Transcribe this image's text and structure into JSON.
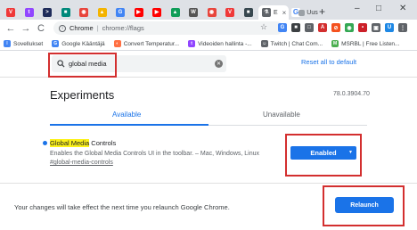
{
  "browser": {
    "tabs": [
      {
        "icon": "vivaldi-icon",
        "glyph": "V",
        "color": "#ef3939"
      },
      {
        "icon": "twitch-icon",
        "glyph": "t",
        "color": "#9146ff"
      },
      {
        "icon": "terminal-icon",
        "glyph": ">",
        "color": "#1f2c5a"
      },
      {
        "icon": "bookmark-icon",
        "glyph": "■",
        "color": "#00897b"
      },
      {
        "icon": "chrome-icon",
        "glyph": "◉",
        "color": "#e8453c"
      },
      {
        "icon": "puzzle-icon",
        "glyph": "▲",
        "color": "#f4b400"
      },
      {
        "icon": "google-icon",
        "glyph": "G",
        "color": "#4285f4"
      },
      {
        "icon": "youtube-icon",
        "glyph": "▶",
        "color": "#ff0000"
      },
      {
        "icon": "youtube-icon",
        "glyph": "▶",
        "color": "#ff0000"
      },
      {
        "icon": "drive-icon",
        "glyph": "▲",
        "color": "#0f9d58"
      },
      {
        "icon": "wikipedia-icon",
        "glyph": "W",
        "color": "#555555"
      },
      {
        "icon": "chrome-icon",
        "glyph": "◉",
        "color": "#e8453c"
      },
      {
        "icon": "vivaldi-icon",
        "glyph": "V",
        "color": "#ef3939"
      },
      {
        "icon": "bookmark-icon",
        "glyph": "■",
        "color": "#37474f"
      }
    ],
    "active_tab": {
      "label": "E",
      "close": "×"
    },
    "extra_tabs": [
      {
        "label": "G",
        "icon": "google-icon"
      },
      {
        "label": "Uus",
        "icon": "page-icon"
      }
    ],
    "new_tab": "+",
    "window_controls": {
      "minimize": "–",
      "maximize": "□",
      "close": "✕"
    }
  },
  "toolbar": {
    "back": "←",
    "forward": "→",
    "reload": "C",
    "url_scheme": "Chrome",
    "url_separator": "|",
    "url_host": "chrome://flags",
    "star": "☆"
  },
  "extensions": [
    {
      "icon": "google-icon",
      "glyph": "G",
      "color": "#4285f4"
    },
    {
      "icon": "extension-icon",
      "glyph": "■",
      "color": "#3c4043"
    },
    {
      "icon": "window-icon",
      "glyph": "□",
      "color": "#5f6368"
    },
    {
      "icon": "adblock-icon",
      "glyph": "A",
      "color": "#d32f2f"
    },
    {
      "icon": "blocker-icon",
      "glyph": "⊘",
      "color": "#f4511e"
    },
    {
      "icon": "chrome-icon",
      "glyph": "◉",
      "color": "#34a853"
    },
    {
      "icon": "lastpass-icon",
      "glyph": "•",
      "color": "#cc2029"
    },
    {
      "icon": "cast-icon",
      "glyph": "▣",
      "color": "#5f6368"
    },
    {
      "icon": "avatar-icon",
      "glyph": "U",
      "color": "#1e88e5"
    },
    {
      "icon": "menu-icon",
      "glyph": "⋮",
      "color": "#5f6368"
    }
  ],
  "bookmarks": [
    {
      "label": "Sovellukset",
      "icon": "apps-icon",
      "glyph": "⁞",
      "color": "#4285f4"
    },
    {
      "label": "Google Kääntäjä",
      "icon": "translate-icon",
      "glyph": "G",
      "color": "#4285f4"
    },
    {
      "label": "Convert Temperatur...",
      "icon": "convert-icon",
      "glyph": "◐",
      "color": "#ff7043"
    },
    {
      "label": "Videoiden hallinta -...",
      "icon": "twitch-icon",
      "glyph": "t",
      "color": "#9146ff"
    },
    {
      "label": "Twitch | Chat Com...",
      "icon": "chat-icon",
      "glyph": "☺",
      "color": "#5f6368"
    },
    {
      "label": "MSRBL | Free Listen...",
      "icon": "msrbl-icon",
      "glyph": "M",
      "color": "#4caf50"
    }
  ],
  "flags": {
    "search_value": "global media",
    "reset_all": "Reset all to default",
    "page_title": "Experiments",
    "version": "78.0.3904.70",
    "tab_available": "Available",
    "tab_unavailable": "Unavailable",
    "experiment": {
      "name_highlight": "Global Media",
      "name_rest": " Controls",
      "description": "Enables the Global Media Controls UI in the toolbar. – Mac, Windows, Linux",
      "anchor": "#global-media-controls",
      "state": "Enabled"
    },
    "relaunch_message": "Your changes will take effect the next time you relaunch Google Chrome.",
    "relaunch_button": "Relaunch"
  },
  "colors": {
    "accent": "#1a73e8",
    "highlight": "#fcf21b",
    "annotation": "#d32f2f"
  }
}
